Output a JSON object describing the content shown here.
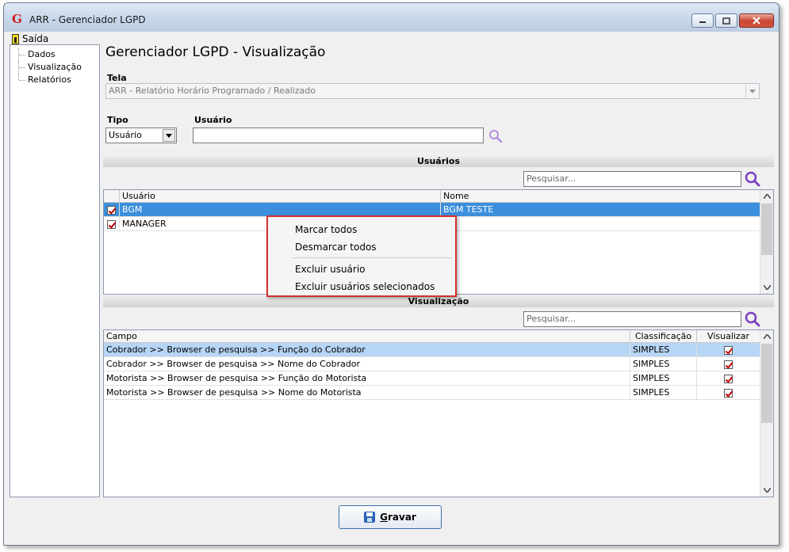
{
  "window": {
    "title": "ARR - Gerenciador LGPD",
    "logo_letter": "G"
  },
  "menu": {
    "exit_label": "Saída"
  },
  "sidebar": {
    "items": [
      "Dados",
      "Visualização",
      "Relatórios"
    ]
  },
  "main": {
    "page_title": "Gerenciador LGPD - Visualização",
    "tela_label": "Tela",
    "tela_value": "ARR - Relatório Horário Programado / Realizado",
    "tipo_label": "Tipo",
    "tipo_value": "Usuário",
    "usuario_label": "Usuário",
    "usuario_value": ""
  },
  "usuarios_section": {
    "title": "Usuários",
    "search_placeholder": "Pesquisar...",
    "columns": [
      "Usuário",
      "Nome"
    ],
    "rows": [
      {
        "user": "BGM",
        "name": "BGM TESTE",
        "checked": true
      },
      {
        "user": "MANAGER",
        "name": "",
        "checked": true
      }
    ]
  },
  "context_menu": {
    "items": [
      "Marcar todos",
      "Desmarcar todos",
      "Excluir usuário",
      "Excluir usuários selecionados"
    ]
  },
  "visualizacao_section": {
    "title": "Visualização",
    "search_placeholder": "Pesquisar...",
    "columns": [
      "Campo",
      "Classificação",
      "Visualizar"
    ],
    "rows": [
      {
        "campo": "Cobrador >> Browser de pesquisa >> Função do Cobrador",
        "classificacao": "SIMPLES",
        "visualizar": true
      },
      {
        "campo": "Cobrador >> Browser de pesquisa >> Nome do Cobrador",
        "classificacao": "SIMPLES",
        "visualizar": true
      },
      {
        "campo": "Motorista >> Browser de pesquisa >> Função do Motorista",
        "classificacao": "SIMPLES",
        "visualizar": true
      },
      {
        "campo": "Motorista >> Browser de pesquisa >> Nome do Motorista",
        "classificacao": "SIMPLES",
        "visualizar": true
      }
    ]
  },
  "footer": {
    "save_label": "Gravar"
  },
  "colors": {
    "selection": "#3c8fdc",
    "highlight": "#b7d5f5",
    "context_border": "#d32f2f",
    "search_icon": "#7b3fbf"
  }
}
